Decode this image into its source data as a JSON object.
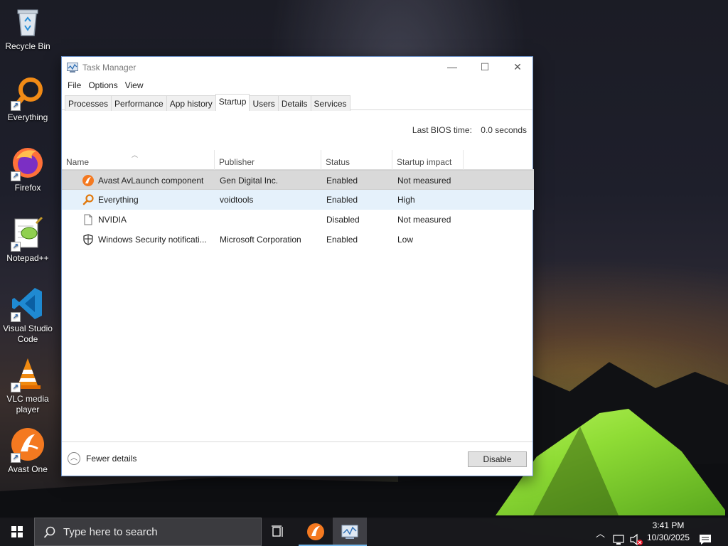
{
  "desktop": {
    "icons": [
      {
        "label": "Recycle Bin"
      },
      {
        "label": "Everything"
      },
      {
        "label": "Firefox"
      },
      {
        "label": "Notepad++"
      },
      {
        "label": "Visual Studio Code"
      },
      {
        "label": "VLC media player"
      },
      {
        "label": "Avast One"
      }
    ]
  },
  "window": {
    "title": "Task Manager",
    "minimize": "—",
    "maximize": "☐",
    "close": "✕",
    "menu": [
      "File",
      "Options",
      "View"
    ],
    "tabs": [
      "Processes",
      "Performance",
      "App history",
      "Startup",
      "Users",
      "Details",
      "Services"
    ],
    "active_tab": "Startup",
    "bios_label": "Last BIOS time:",
    "bios_value": "0.0 seconds",
    "columns": [
      "Name",
      "Publisher",
      "Status",
      "Startup impact"
    ],
    "rows": [
      {
        "name": "Avast AvLaunch component",
        "publisher": "Gen Digital Inc.",
        "status": "Enabled",
        "impact": "Not measured",
        "icon": "avast-icon",
        "state": "selected"
      },
      {
        "name": "Everything",
        "publisher": "voidtools",
        "status": "Enabled",
        "impact": "High",
        "icon": "everything-icon",
        "state": "hover"
      },
      {
        "name": "NVIDIA",
        "publisher": "",
        "status": "Disabled",
        "impact": "Not measured",
        "icon": "file-icon",
        "state": ""
      },
      {
        "name": "Windows Security notificati...",
        "publisher": "Microsoft Corporation",
        "status": "Enabled",
        "impact": "Low",
        "icon": "shield-icon",
        "state": ""
      }
    ],
    "fewer_details": "Fewer details",
    "disable_button": "Disable"
  },
  "taskbar": {
    "search_placeholder": "Type here to search",
    "time": "3:41 PM",
    "date": "10/30/2025"
  },
  "colors": {
    "accent": "#76b9ed",
    "selected_row": "#d9d9d9",
    "hover_row": "#e5f1fb",
    "avast_orange": "#f47920"
  }
}
